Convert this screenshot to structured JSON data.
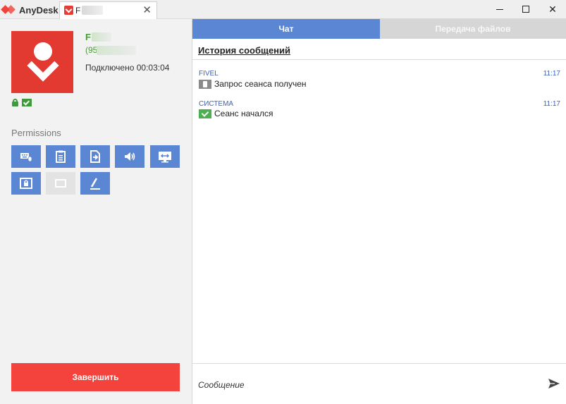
{
  "app": {
    "name": "AnyDesk"
  },
  "tab": {
    "label": "F",
    "close": "✕"
  },
  "window": {
    "minimize": "—",
    "maximize": "☐",
    "close": "✕"
  },
  "session": {
    "user_name": "F",
    "user_id": "(95",
    "connected": "Подключено 00:03:04"
  },
  "permissions": {
    "title": "Permissions",
    "buttons": [
      {
        "icon": "keyboard-mouse-icon",
        "enabled": true
      },
      {
        "icon": "clipboard-icon",
        "enabled": true
      },
      {
        "icon": "file-transfer-icon",
        "enabled": true
      },
      {
        "icon": "sound-icon",
        "enabled": true
      },
      {
        "icon": "control-screen-icon",
        "enabled": true
      },
      {
        "icon": "lock-screen-icon",
        "enabled": true
      },
      {
        "icon": "privacy-screen-icon",
        "enabled": false
      },
      {
        "icon": "draw-icon",
        "enabled": true
      }
    ]
  },
  "end_button": "Завершить",
  "chat": {
    "tabs": [
      "Чат",
      "Передача файлов"
    ],
    "history_title": "История сообщений",
    "messages": [
      {
        "sender": "FIVEL",
        "time": "11:17",
        "text": "Запрос сеанса получен",
        "icon": "session-request-icon"
      },
      {
        "sender": "СИСТЕМА",
        "time": "11:17",
        "text": "Сеанс начался",
        "icon": "session-started-icon"
      }
    ],
    "input_placeholder": "Сообщение"
  },
  "colors": {
    "accent": "#5b86d3",
    "brand": "#e23a31",
    "end": "#f4433c",
    "online": "#4a9a3a"
  }
}
